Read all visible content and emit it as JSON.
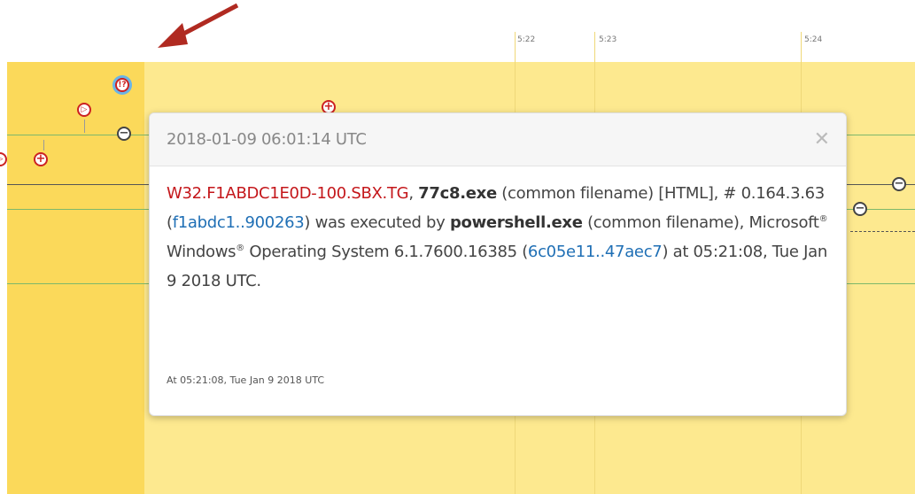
{
  "timeline": {
    "ticks": [
      "5:22",
      "5:23",
      "5:24"
    ]
  },
  "popup": {
    "title": "2018-01-09 06:01:14 UTC",
    "close_icon": "close-icon",
    "malware_name": "W32.F1ABDC1E0D-100.SBX.TG",
    "sep1": ", ",
    "file_name": "77c8.exe",
    "file_desc": " (common filename) [HTML], # 0.164.3.63 (",
    "file_hash": "f1abdc1..900263",
    "executed_by": ") was executed by ",
    "parent_name": "powershell.exe",
    "parent_desc": " (common filename), Microsoft",
    "reg1": "®",
    "windows": " Windows",
    "reg2": "®",
    "os_desc": " Operating System 6.1.7600.16385 (",
    "parent_hash": "6c05e11..47aec7",
    "time_desc": ") at 05:21:08, Tue Jan 9 2018 UTC.",
    "footer": "At 05:21:08, Tue Jan 9 2018 UTC"
  },
  "colors": {
    "malware": "#c4171b",
    "hash_link": "#1f6fb5",
    "band_left": "#fbd95a",
    "band_main": "#fde98f",
    "arrow": "#b02a21"
  },
  "icons": [
    "arrow-pointer-icon",
    "alert-icon",
    "play-icon",
    "plus-icon",
    "minus-icon"
  ]
}
